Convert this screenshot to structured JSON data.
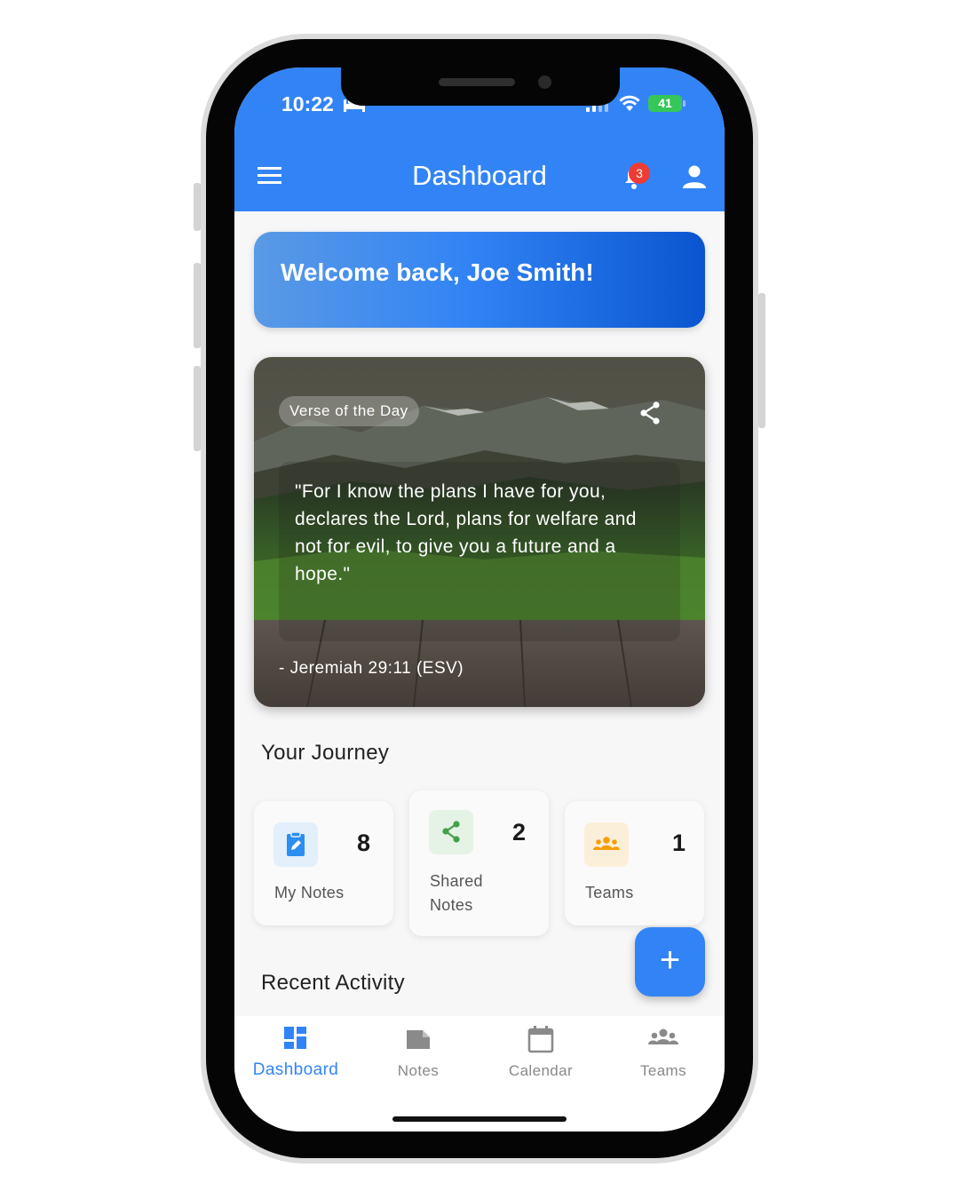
{
  "status_bar": {
    "time": "10:22",
    "battery": "41"
  },
  "header": {
    "title": "Dashboard",
    "notification_count": "3"
  },
  "welcome": {
    "text": "Welcome back, Joe Smith!"
  },
  "verse": {
    "label": "Verse of the Day",
    "text": "\"For I know the plans I have for you, declares the Lord, plans for welfare and not for evil, to give you a future and a hope.\"",
    "reference": "- Jeremiah 29:11 (ESV)"
  },
  "journey": {
    "title": "Your Journey",
    "cards": [
      {
        "label": "My Notes",
        "count": "8",
        "icon": "note-edit-icon",
        "color": "#2b8ef0"
      },
      {
        "label_line1": "Shared",
        "label_line2": "Notes",
        "count": "2",
        "icon": "share-icon",
        "color": "#43a047"
      },
      {
        "label": "Teams",
        "count": "1",
        "icon": "groups-icon",
        "color": "#f59e0b"
      }
    ]
  },
  "recent": {
    "title": "Recent Activity"
  },
  "fab": {
    "label": "+"
  },
  "nav": {
    "items": [
      {
        "label": "Dashboard",
        "icon": "dashboard-icon",
        "active": true
      },
      {
        "label": "Notes",
        "icon": "notes-icon",
        "active": false
      },
      {
        "label": "Calendar",
        "icon": "calendar-icon",
        "active": false
      },
      {
        "label": "Teams",
        "icon": "groups-icon",
        "active": false
      }
    ]
  },
  "colors": {
    "primary": "#3284f6",
    "badge": "#ef3b33",
    "battery": "#35c759"
  }
}
